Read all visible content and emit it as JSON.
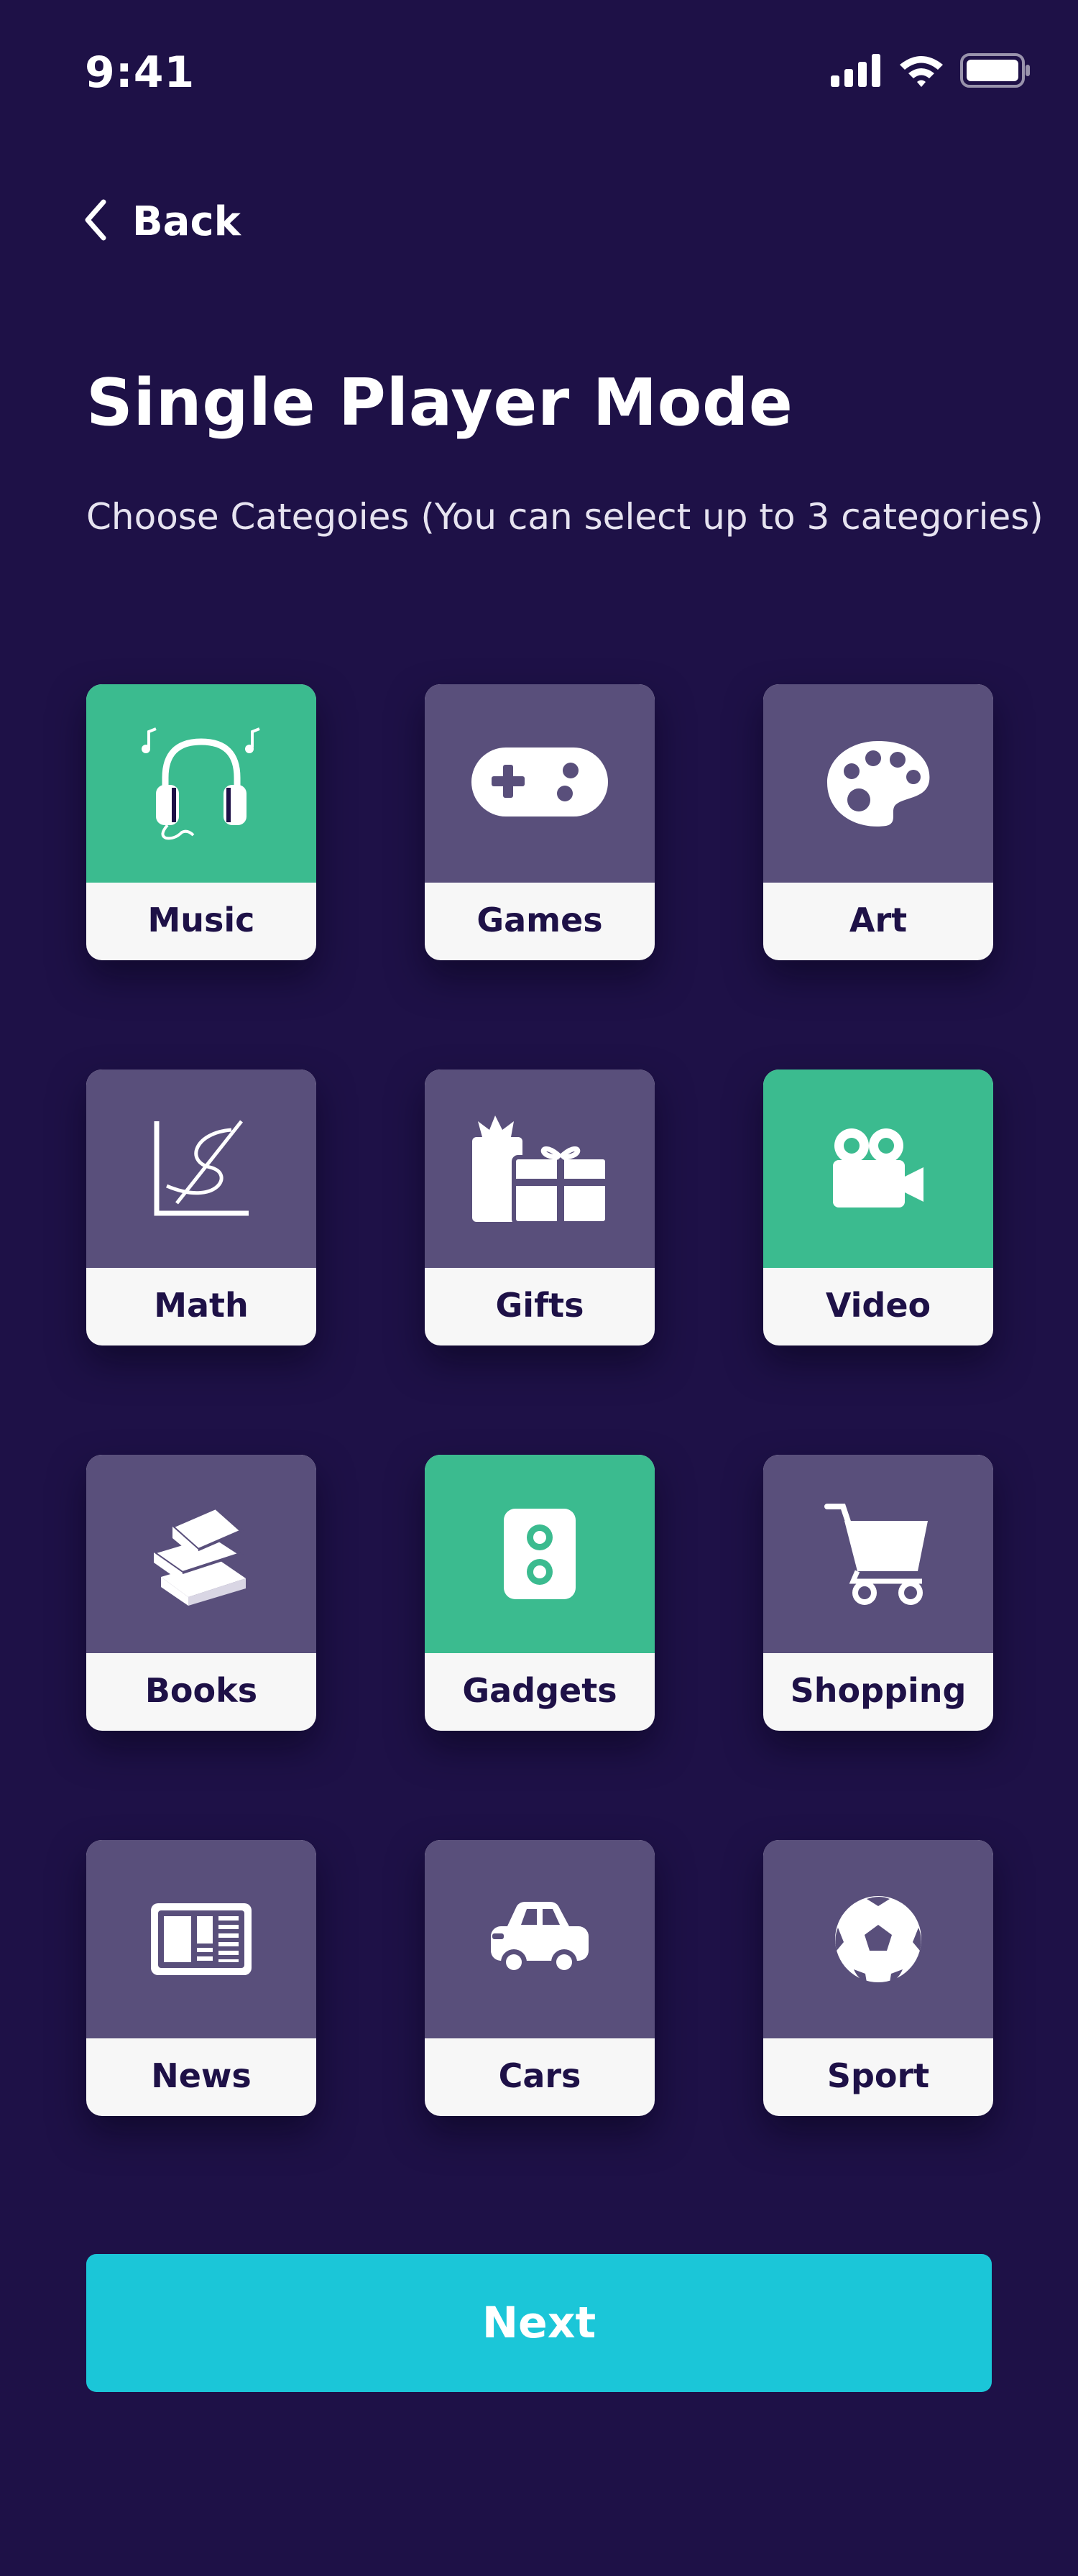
{
  "status_bar": {
    "time": "9:41"
  },
  "nav": {
    "back_label": "Back"
  },
  "header": {
    "title": "Single Player Mode",
    "subtitle": "Choose Categoies (You can select up to 3 categories)"
  },
  "categories": [
    {
      "label": "Music",
      "icon": "headphones-icon",
      "selected": true
    },
    {
      "label": "Games",
      "icon": "gamepad-icon",
      "selected": false
    },
    {
      "label": "Art",
      "icon": "palette-icon",
      "selected": false
    },
    {
      "label": "Math",
      "icon": "graph-icon",
      "selected": false
    },
    {
      "label": "Gifts",
      "icon": "gift-icon",
      "selected": false
    },
    {
      "label": "Video",
      "icon": "video-camera-icon",
      "selected": true
    },
    {
      "label": "Books",
      "icon": "books-icon",
      "selected": false
    },
    {
      "label": "Gadgets",
      "icon": "speaker-icon",
      "selected": true
    },
    {
      "label": "Shopping",
      "icon": "cart-icon",
      "selected": false
    },
    {
      "label": "News",
      "icon": "newspaper-icon",
      "selected": false
    },
    {
      "label": "Cars",
      "icon": "car-icon",
      "selected": false
    },
    {
      "label": "Sport",
      "icon": "soccer-ball-icon",
      "selected": false
    }
  ],
  "actions": {
    "next_label": "Next"
  },
  "colors": {
    "background": "#1e1147",
    "card_default": "#594f7b",
    "card_selected": "#3bbb8f",
    "label_background": "#f7f7f7",
    "button": "#1bc6d8"
  }
}
